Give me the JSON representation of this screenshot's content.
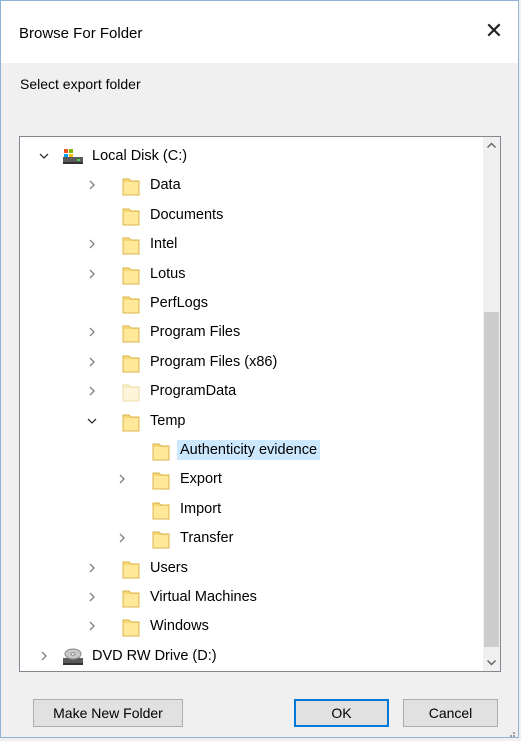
{
  "dialog": {
    "title": "Browse For Folder",
    "close_glyph": "✕",
    "instruction": "Select export folder"
  },
  "tree": {
    "items": [
      {
        "label": "Local Disk (C:)",
        "icon": "local-disk-icon",
        "expander": "expanded",
        "level": 0
      },
      {
        "label": "Data",
        "icon": "folder-icon",
        "expander": "collapsed",
        "level": 1
      },
      {
        "label": "Documents",
        "icon": "folder-icon",
        "expander": "none",
        "level": 1
      },
      {
        "label": "Intel",
        "icon": "folder-icon",
        "expander": "collapsed",
        "level": 1
      },
      {
        "label": "Lotus",
        "icon": "folder-icon",
        "expander": "collapsed",
        "level": 1
      },
      {
        "label": "PerfLogs",
        "icon": "folder-icon",
        "expander": "none",
        "level": 1
      },
      {
        "label": "Program Files",
        "icon": "folder-icon",
        "expander": "collapsed",
        "level": 1
      },
      {
        "label": "Program Files (x86)",
        "icon": "folder-icon",
        "expander": "collapsed",
        "level": 1
      },
      {
        "label": "ProgramData",
        "icon": "folder-hidden-icon",
        "expander": "collapsed",
        "level": 1
      },
      {
        "label": "Temp",
        "icon": "folder-icon",
        "expander": "expanded",
        "level": 1
      },
      {
        "label": "Authenticity evidence",
        "icon": "folder-icon",
        "expander": "none",
        "level": 2,
        "selected": true
      },
      {
        "label": "Export",
        "icon": "folder-icon",
        "expander": "collapsed",
        "level": 2
      },
      {
        "label": "Import",
        "icon": "folder-icon",
        "expander": "none",
        "level": 2
      },
      {
        "label": "Transfer",
        "icon": "folder-icon",
        "expander": "collapsed",
        "level": 2
      },
      {
        "label": "Users",
        "icon": "folder-icon",
        "expander": "collapsed",
        "level": 1
      },
      {
        "label": "Virtual Machines",
        "icon": "folder-icon",
        "expander": "collapsed",
        "level": 1
      },
      {
        "label": "Windows",
        "icon": "folder-icon",
        "expander": "collapsed",
        "level": 1
      },
      {
        "label": "DVD RW Drive (D:)",
        "icon": "dvd-drive-icon",
        "expander": "collapsed",
        "level": 0
      }
    ]
  },
  "buttons": {
    "make_new_folder": "Make New Folder",
    "ok": "OK",
    "cancel": "Cancel"
  },
  "colors": {
    "selection": "#cce8ff",
    "folder": "#f8d775",
    "accent": "#0078d7"
  }
}
